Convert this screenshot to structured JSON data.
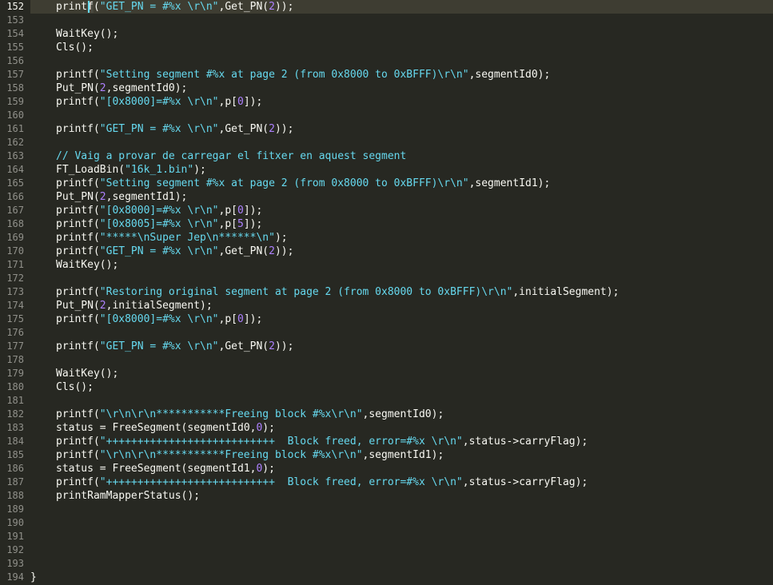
{
  "editor": {
    "lines": [
      {
        "n": "152",
        "tokens": [
          [
            "fn",
            "print"
          ],
          [
            "cursor",
            "f"
          ],
          [
            "p",
            "("
          ],
          [
            "str",
            "\"GET_PN = #%x \\r\\n\""
          ],
          [
            "p",
            ",Get_PN("
          ],
          [
            "num",
            "2"
          ],
          [
            "p",
            "));"
          ]
        ]
      },
      {
        "n": "153",
        "tokens": []
      },
      {
        "n": "154",
        "tokens": [
          [
            "fn",
            "WaitKey"
          ],
          [
            "p",
            "();"
          ]
        ]
      },
      {
        "n": "155",
        "tokens": [
          [
            "fn",
            "Cls"
          ],
          [
            "p",
            "();"
          ]
        ]
      },
      {
        "n": "156",
        "tokens": []
      },
      {
        "n": "157",
        "tokens": [
          [
            "fn",
            "printf"
          ],
          [
            "p",
            "("
          ],
          [
            "str",
            "\"Setting segment #%x at page 2 (from 0x8000 to 0xBFFF)\\r\\n\""
          ],
          [
            "p",
            ",segmentId0);"
          ]
        ]
      },
      {
        "n": "158",
        "tokens": [
          [
            "fn",
            "Put_PN"
          ],
          [
            "p",
            "("
          ],
          [
            "num",
            "2"
          ],
          [
            "p",
            ",segmentId0);"
          ]
        ]
      },
      {
        "n": "159",
        "tokens": [
          [
            "fn",
            "printf"
          ],
          [
            "p",
            "("
          ],
          [
            "str",
            "\"[0x8000]=#%x \\r\\n\""
          ],
          [
            "p",
            ",p["
          ],
          [
            "num",
            "0"
          ],
          [
            "p",
            "]);"
          ]
        ]
      },
      {
        "n": "160",
        "tokens": []
      },
      {
        "n": "161",
        "tokens": [
          [
            "fn",
            "printf"
          ],
          [
            "p",
            "("
          ],
          [
            "str",
            "\"GET_PN = #%x \\r\\n\""
          ],
          [
            "p",
            ",Get_PN("
          ],
          [
            "num",
            "2"
          ],
          [
            "p",
            "));"
          ]
        ]
      },
      {
        "n": "162",
        "tokens": []
      },
      {
        "n": "163",
        "tokens": [
          [
            "comment",
            "// Vaig a provar de carregar el fitxer en aquest segment"
          ]
        ]
      },
      {
        "n": "164",
        "tokens": [
          [
            "fn",
            "FT_LoadBin"
          ],
          [
            "p",
            "("
          ],
          [
            "str",
            "\"16k_1.bin\""
          ],
          [
            "p",
            ");"
          ]
        ]
      },
      {
        "n": "165",
        "tokens": [
          [
            "fn",
            "printf"
          ],
          [
            "p",
            "("
          ],
          [
            "str",
            "\"Setting segment #%x at page 2 (from 0x8000 to 0xBFFF)\\r\\n\""
          ],
          [
            "p",
            ",segmentId1);"
          ]
        ]
      },
      {
        "n": "166",
        "tokens": [
          [
            "fn",
            "Put_PN"
          ],
          [
            "p",
            "("
          ],
          [
            "num",
            "2"
          ],
          [
            "p",
            ",segmentId1);"
          ]
        ]
      },
      {
        "n": "167",
        "tokens": [
          [
            "fn",
            "printf"
          ],
          [
            "p",
            "("
          ],
          [
            "str",
            "\"[0x8000]=#%x \\r\\n\""
          ],
          [
            "p",
            ",p["
          ],
          [
            "num",
            "0"
          ],
          [
            "p",
            "]);"
          ]
        ]
      },
      {
        "n": "168",
        "tokens": [
          [
            "fn",
            "printf"
          ],
          [
            "p",
            "("
          ],
          [
            "str",
            "\"[0x8005]=#%x \\r\\n\""
          ],
          [
            "p",
            ",p["
          ],
          [
            "num",
            "5"
          ],
          [
            "p",
            "]);"
          ]
        ]
      },
      {
        "n": "169",
        "tokens": [
          [
            "fn",
            "printf"
          ],
          [
            "p",
            "("
          ],
          [
            "str",
            "\"*****\\nSuper Jep\\n******\\n\""
          ],
          [
            "p",
            ");"
          ]
        ]
      },
      {
        "n": "170",
        "tokens": [
          [
            "fn",
            "printf"
          ],
          [
            "p",
            "("
          ],
          [
            "str",
            "\"GET_PN = #%x \\r\\n\""
          ],
          [
            "p",
            ",Get_PN("
          ],
          [
            "num",
            "2"
          ],
          [
            "p",
            "));"
          ]
        ]
      },
      {
        "n": "171",
        "tokens": [
          [
            "fn",
            "WaitKey"
          ],
          [
            "p",
            "();"
          ]
        ]
      },
      {
        "n": "172",
        "tokens": []
      },
      {
        "n": "173",
        "tokens": [
          [
            "fn",
            "printf"
          ],
          [
            "p",
            "("
          ],
          [
            "str",
            "\"Restoring original segment at page 2 (from 0x8000 to 0xBFFF)\\r\\n\""
          ],
          [
            "p",
            ",initialSegment);"
          ]
        ]
      },
      {
        "n": "174",
        "tokens": [
          [
            "fn",
            "Put_PN"
          ],
          [
            "p",
            "("
          ],
          [
            "num",
            "2"
          ],
          [
            "p",
            ",initialSegment);"
          ]
        ]
      },
      {
        "n": "175",
        "tokens": [
          [
            "fn",
            "printf"
          ],
          [
            "p",
            "("
          ],
          [
            "str",
            "\"[0x8000]=#%x \\r\\n\""
          ],
          [
            "p",
            ",p["
          ],
          [
            "num",
            "0"
          ],
          [
            "p",
            "]);"
          ]
        ]
      },
      {
        "n": "176",
        "tokens": []
      },
      {
        "n": "177",
        "tokens": [
          [
            "fn",
            "printf"
          ],
          [
            "p",
            "("
          ],
          [
            "str",
            "\"GET_PN = #%x \\r\\n\""
          ],
          [
            "p",
            ",Get_PN("
          ],
          [
            "num",
            "2"
          ],
          [
            "p",
            "));"
          ]
        ]
      },
      {
        "n": "178",
        "tokens": []
      },
      {
        "n": "179",
        "tokens": [
          [
            "fn",
            "WaitKey"
          ],
          [
            "p",
            "();"
          ]
        ]
      },
      {
        "n": "180",
        "tokens": [
          [
            "fn",
            "Cls"
          ],
          [
            "p",
            "();"
          ]
        ]
      },
      {
        "n": "181",
        "tokens": []
      },
      {
        "n": "182",
        "tokens": [
          [
            "fn",
            "printf"
          ],
          [
            "p",
            "("
          ],
          [
            "str",
            "\"\\r\\n\\r\\n***********Freeing block #%x\\r\\n\""
          ],
          [
            "p",
            ",segmentId0);"
          ]
        ]
      },
      {
        "n": "183",
        "tokens": [
          [
            "p",
            "status = "
          ],
          [
            "fn",
            "FreeSegment"
          ],
          [
            "p",
            "(segmentId0,"
          ],
          [
            "num",
            "0"
          ],
          [
            "p",
            ");"
          ]
        ]
      },
      {
        "n": "184",
        "tokens": [
          [
            "fn",
            "printf"
          ],
          [
            "p",
            "("
          ],
          [
            "str",
            "\"+++++++++++++++++++++++++++  Block freed, error=#%x \\r\\n\""
          ],
          [
            "p",
            ",status->carryFlag);"
          ]
        ]
      },
      {
        "n": "185",
        "tokens": [
          [
            "fn",
            "printf"
          ],
          [
            "p",
            "("
          ],
          [
            "str",
            "\"\\r\\n\\r\\n***********Freeing block #%x\\r\\n\""
          ],
          [
            "p",
            ",segmentId1);"
          ]
        ]
      },
      {
        "n": "186",
        "tokens": [
          [
            "p",
            "status = "
          ],
          [
            "fn",
            "FreeSegment"
          ],
          [
            "p",
            "(segmentId1,"
          ],
          [
            "num",
            "0"
          ],
          [
            "p",
            ");"
          ]
        ]
      },
      {
        "n": "187",
        "tokens": [
          [
            "fn",
            "printf"
          ],
          [
            "p",
            "("
          ],
          [
            "str",
            "\"+++++++++++++++++++++++++++  Block freed, error=#%x \\r\\n\""
          ],
          [
            "p",
            ",status->carryFlag);"
          ]
        ]
      },
      {
        "n": "188",
        "tokens": [
          [
            "fn",
            "printRamMapperStatus"
          ],
          [
            "p",
            "();"
          ]
        ]
      },
      {
        "n": "189",
        "tokens": []
      },
      {
        "n": "190",
        "tokens": []
      },
      {
        "n": "191",
        "tokens": []
      },
      {
        "n": "192",
        "tokens": []
      },
      {
        "n": "193",
        "tokens": []
      },
      {
        "n": "194",
        "tokens": [
          [
            "p",
            "}"
          ]
        ],
        "brace": true
      }
    ],
    "active_line": "152"
  }
}
